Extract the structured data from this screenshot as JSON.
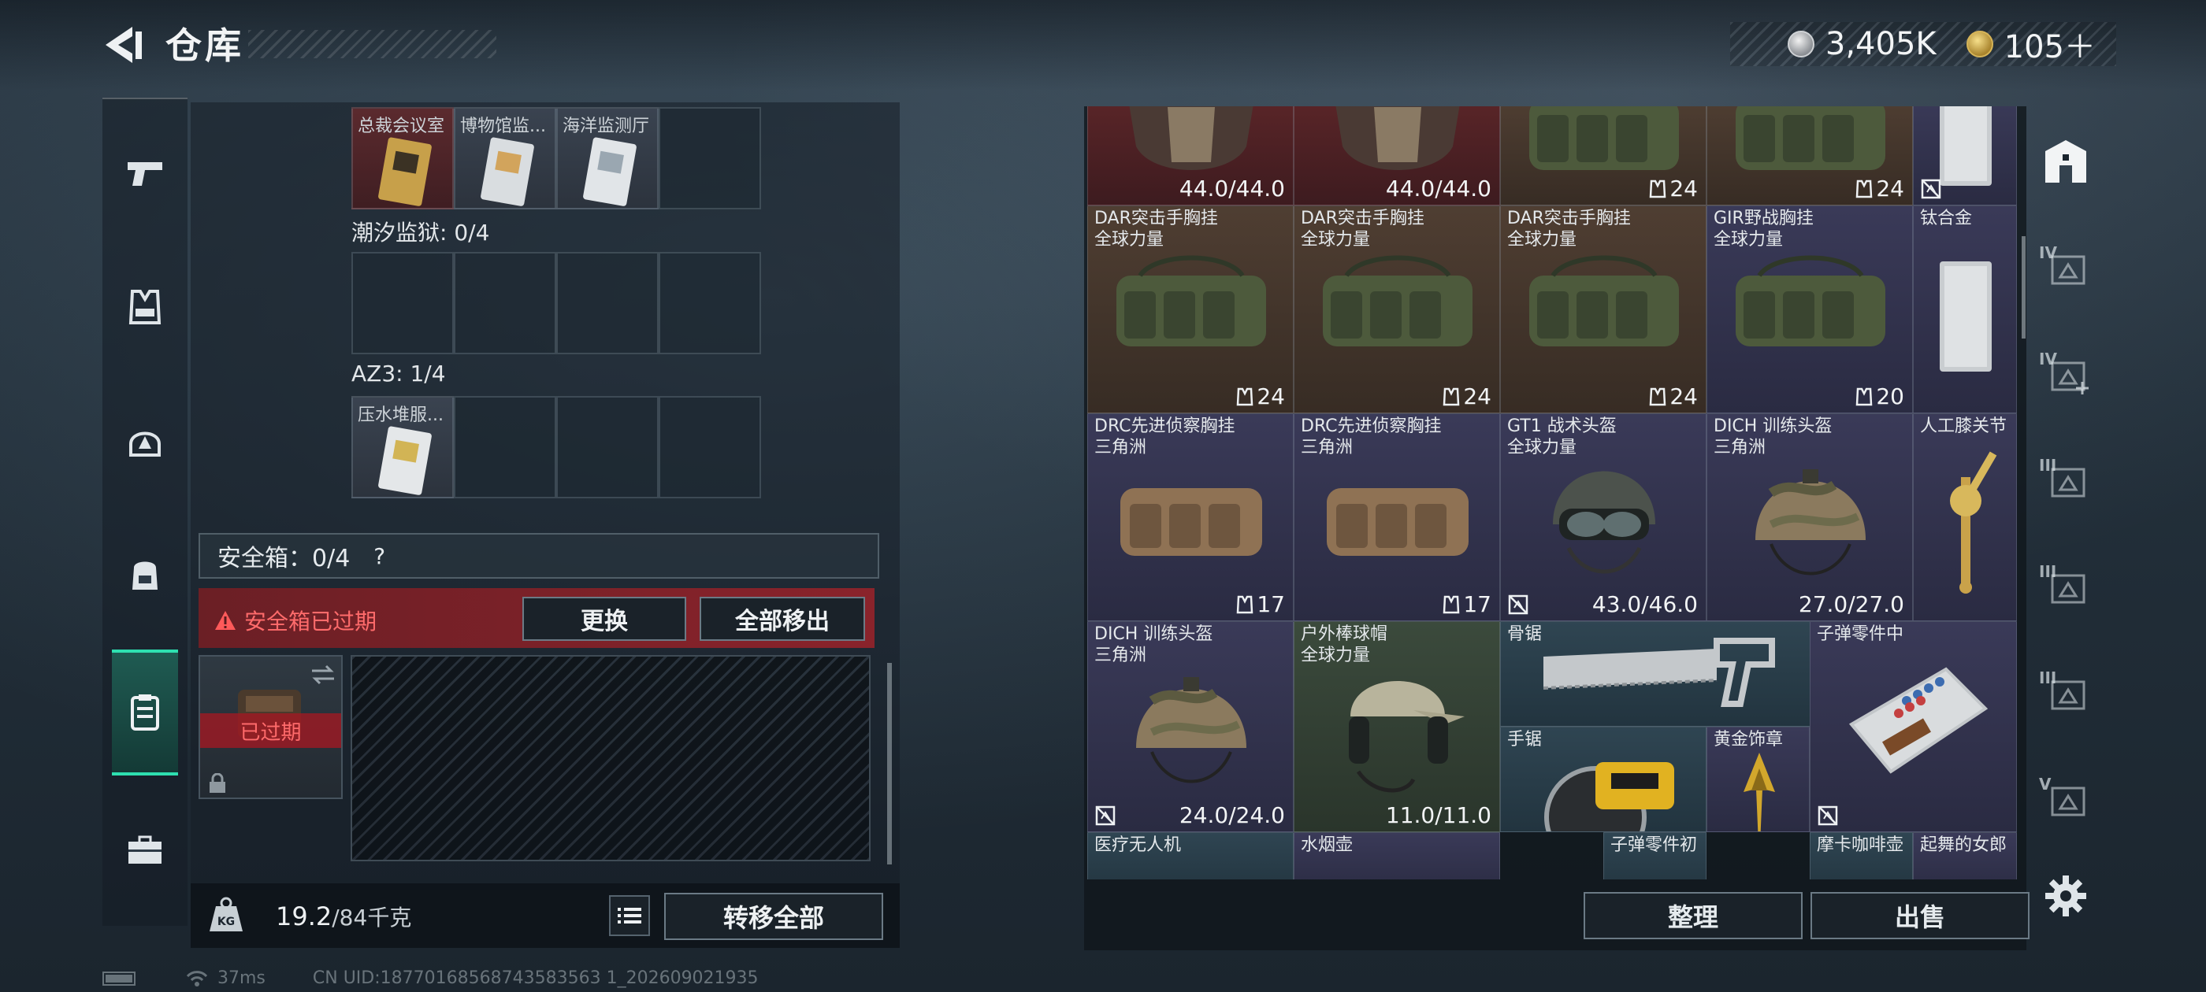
{
  "header": {
    "title": "仓库",
    "currencies": [
      {
        "icon": "silver-coin-icon",
        "value": "3,405K"
      },
      {
        "icon": "gold-coin-icon",
        "value": "105＋"
      }
    ]
  },
  "rail": {
    "items": [
      {
        "icon": "pistol-icon"
      },
      {
        "icon": "vest-icon"
      },
      {
        "icon": "helmet-icon"
      },
      {
        "icon": "backpack-icon"
      },
      {
        "icon": "safe-box-icon",
        "active": true
      },
      {
        "icon": "briefcase-icon"
      }
    ]
  },
  "storage": {
    "top_items": [
      {
        "name": "总裁会议室",
        "color": "red"
      },
      {
        "name": "博物馆监...",
        "color": "grey"
      },
      {
        "name": "海洋监测厅",
        "color": "grey"
      }
    ],
    "sections": [
      {
        "label": "潮汐监狱: 0/4",
        "items": []
      },
      {
        "label": "AZ3: 1/4",
        "items": [
          {
            "name": "压水堆服...",
            "color": "grey"
          }
        ]
      }
    ]
  },
  "safe_box": {
    "label": "安全箱：0/4",
    "help": "?",
    "warning": "安全箱已过期",
    "replace_label": "更换",
    "move_all_label": "全部移出",
    "expired_badge": "已过期"
  },
  "weight": {
    "current": "19.2",
    "capacity": "/84千克",
    "transfer_all_label": "转移全部"
  },
  "inventory": {
    "cells": [
      {
        "name": "",
        "sub": "",
        "value": "44.0/44.0",
        "value_type": "dur",
        "color": "red",
        "art": "helmet-face"
      },
      {
        "name": "",
        "sub": "",
        "value": "44.0/44.0",
        "value_type": "dur",
        "color": "red",
        "art": "helmet-face"
      },
      {
        "name": "",
        "sub": "",
        "value": "24",
        "value_type": "cnt",
        "color": "brown",
        "art": "rig-green"
      },
      {
        "name": "",
        "sub": "",
        "value": "24",
        "value_type": "cnt",
        "color": "brown",
        "art": "rig-green"
      },
      {
        "name": "",
        "sub": "",
        "value": "",
        "value_type": "none",
        "color": "purple",
        "art": "plate",
        "noins": true
      },
      {
        "name": "DAR突击手胸挂",
        "sub": "全球力量",
        "value": "24",
        "value_type": "cnt",
        "color": "brown",
        "art": "rig-green"
      },
      {
        "name": "DAR突击手胸挂",
        "sub": "全球力量",
        "value": "24",
        "value_type": "cnt",
        "color": "brown",
        "art": "rig-green"
      },
      {
        "name": "DAR突击手胸挂",
        "sub": "全球力量",
        "value": "24",
        "value_type": "cnt",
        "color": "brown",
        "art": "rig-green"
      },
      {
        "name": "GIR野战胸挂",
        "sub": "全球力量",
        "value": "20",
        "value_type": "cnt",
        "color": "purple",
        "art": "rig-green"
      },
      {
        "name": "钛合金",
        "sub": "",
        "value": "",
        "value_type": "none",
        "color": "purple",
        "art": "plate"
      },
      {
        "name": "DRC先进侦察胸挂",
        "sub": "三角洲",
        "value": "17",
        "value_type": "cnt",
        "color": "purple",
        "art": "rig-tan"
      },
      {
        "name": "DRC先进侦察胸挂",
        "sub": "三角洲",
        "value": "17",
        "value_type": "cnt",
        "color": "purple",
        "art": "rig-tan"
      },
      {
        "name": "GT1 战术头盔",
        "sub": "全球力量",
        "value": "43.0/46.0",
        "value_type": "dur",
        "color": "purple",
        "art": "helmet-goggle",
        "noins": true
      },
      {
        "name": "DICH 训练头盔",
        "sub": "三角洲",
        "value": "27.0/27.0",
        "value_type": "dur",
        "color": "purple",
        "art": "helmet-camo"
      },
      {
        "name": "人工膝关节",
        "sub": "",
        "value": "",
        "value_type": "none",
        "color": "purple",
        "art": "knee"
      },
      {
        "name": "DICH 训练头盔",
        "sub": "三角洲",
        "value": "24.0/24.0",
        "value_type": "dur",
        "color": "purple",
        "art": "helmet-camo",
        "noins": true
      },
      {
        "name": "户外棒球帽",
        "sub": "全球力量",
        "value": "11.0/11.0",
        "value_type": "dur",
        "color": "green",
        "art": "cap"
      },
      {
        "name": "骨锯",
        "sub": "",
        "value": "",
        "value_type": "none",
        "color": "blue",
        "art": "saw"
      },
      {
        "name": "子弹零件中",
        "sub": "",
        "value": "",
        "value_type": "none",
        "color": "purple",
        "art": "ammo-box",
        "noins": true
      },
      {
        "name": "手锯",
        "sub": "",
        "value": "",
        "value_type": "none",
        "color": "blue",
        "art": "circular-saw"
      },
      {
        "name": "黄金饰章",
        "sub": "",
        "value": "",
        "value_type": "none",
        "color": "purple",
        "art": "gold-badge"
      },
      {
        "name": "医疗无人机",
        "sub": "",
        "value": "",
        "value_type": "none",
        "color": "blue",
        "art": "none"
      },
      {
        "name": "水烟壶",
        "sub": "",
        "value": "",
        "value_type": "none",
        "color": "purple",
        "art": "none"
      },
      {
        "name": "子弹零件初",
        "sub": "",
        "value": "",
        "value_type": "none",
        "color": "blue",
        "art": "none"
      },
      {
        "name": "摩卡咖啡壶",
        "sub": "",
        "value": "",
        "value_type": "none",
        "color": "blue",
        "art": "none"
      },
      {
        "name": "起舞的女郎",
        "sub": "",
        "value": "",
        "value_type": "none",
        "color": "purple",
        "art": "none"
      }
    ],
    "sort_label": "整理",
    "sell_label": "出售"
  },
  "side_tabs": [
    {
      "icon": "home-base-icon",
      "label": ""
    },
    {
      "icon": "storage-tab-icon",
      "label": "IV"
    },
    {
      "icon": "storage-add-tab-icon",
      "label": "IV"
    },
    {
      "icon": "storage-tab-icon",
      "label": "III"
    },
    {
      "icon": "storage-tab-icon",
      "label": "III"
    },
    {
      "icon": "storage-tab-icon",
      "label": "III"
    },
    {
      "icon": "storage-tab-icon",
      "label": "V"
    }
  ],
  "footer": {
    "ping": "37ms",
    "uid": "CN UID:18770168568743583563 1_202609021935"
  }
}
